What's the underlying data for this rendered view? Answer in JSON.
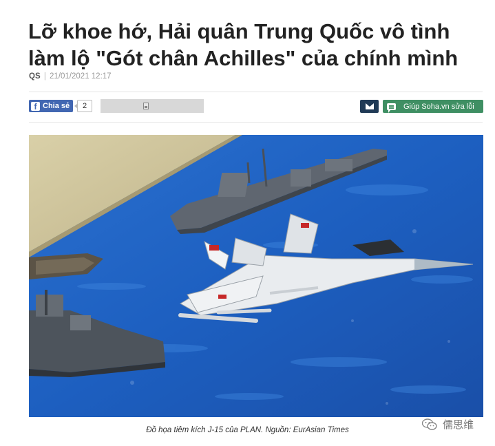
{
  "article": {
    "title": "Lỡ khoe hớ, Hải quân Trung Quốc vô tình làm lộ \"Gót chân Achilles\" của chính mình",
    "source": "QS",
    "separator": "|",
    "datetime": "21/01/2021 12:17"
  },
  "share": {
    "facebook_label": "Chia sẻ",
    "facebook_icon": "facebook-icon",
    "count": "2",
    "save_icon": "save-icon"
  },
  "actions": {
    "email_icon": "envelope-icon",
    "feedback_icon": "chat-bubble-icon",
    "feedback_label": "Giúp Soha.vn sửa lỗi"
  },
  "image": {
    "caption": "Đồ họa tiêm kích J-15 của PLAN. Nguồn: EurAsian Times"
  },
  "watermark": {
    "text": "儒思维",
    "icon": "wechat-icon"
  },
  "colors": {
    "facebook": "#4267b2",
    "email_button": "#203a56",
    "feedback_button": "#3f8f63",
    "sea": "#1f63c2"
  }
}
